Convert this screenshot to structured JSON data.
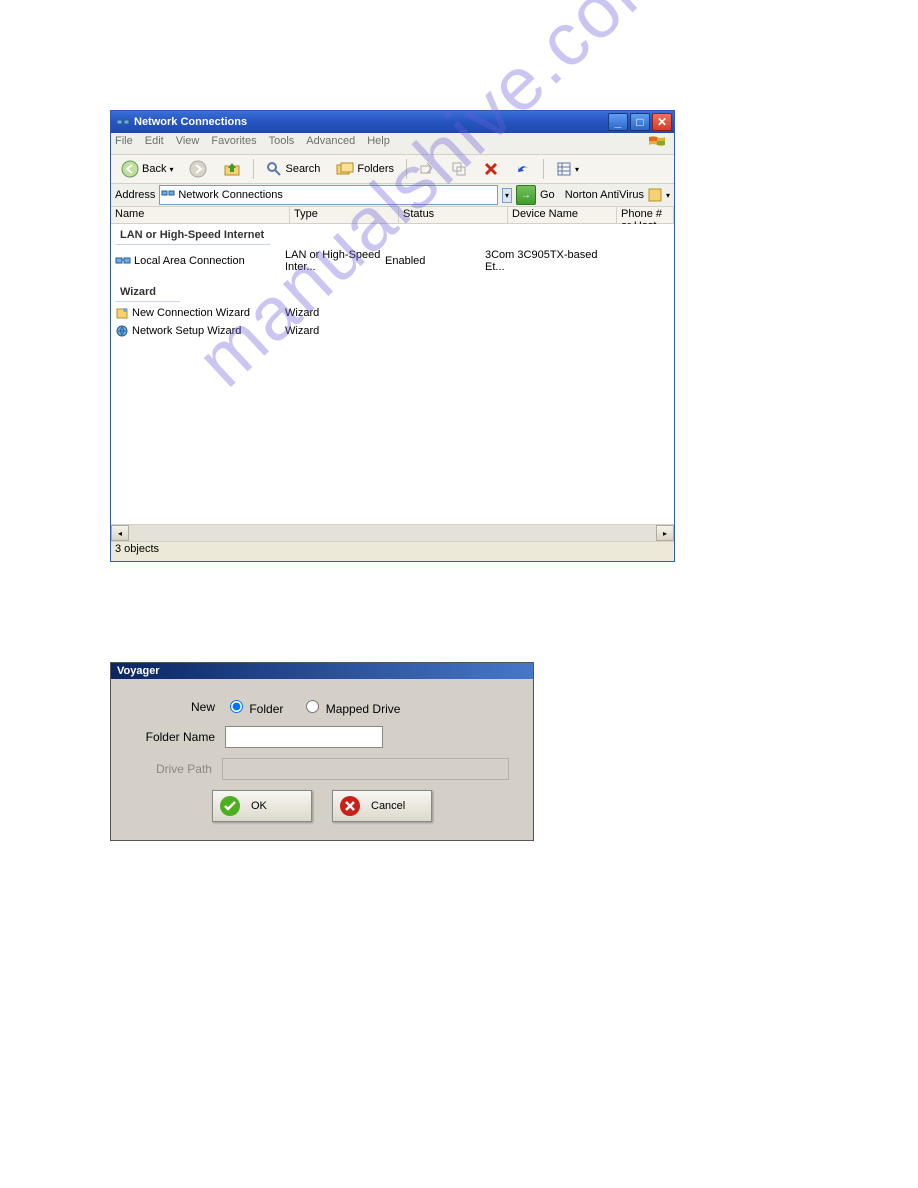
{
  "watermark": "manualshive.com",
  "win1": {
    "title": "Network Connections",
    "menu": [
      "File",
      "Edit",
      "View",
      "Favorites",
      "Tools",
      "Advanced",
      "Help"
    ],
    "back": "Back",
    "search": "Search",
    "folders": "Folders",
    "addr_label": "Address",
    "addr_value": "Network Connections",
    "go": "Go",
    "norton": "Norton AntiVirus",
    "cols": [
      "Name",
      "Type",
      "Status",
      "Device Name",
      "Phone # or Host Addr"
    ],
    "group1": "LAN or High-Speed Internet",
    "row1": {
      "name": "Local Area Connection",
      "type": "LAN or High-Speed Inter...",
      "status": "Enabled",
      "device": "3Com 3C905TX-based Et..."
    },
    "group2": "Wizard",
    "row2": {
      "name": "New Connection Wizard",
      "type": "Wizard"
    },
    "row3": {
      "name": "Network Setup Wizard",
      "type": "Wizard"
    },
    "status": "3 objects"
  },
  "win2": {
    "title": "Voyager",
    "new": "New",
    "folder": "Folder",
    "mapped": "Mapped Drive",
    "foldername": "Folder Name",
    "drivepath": "Drive Path",
    "ok": "OK",
    "cancel": "Cancel"
  }
}
